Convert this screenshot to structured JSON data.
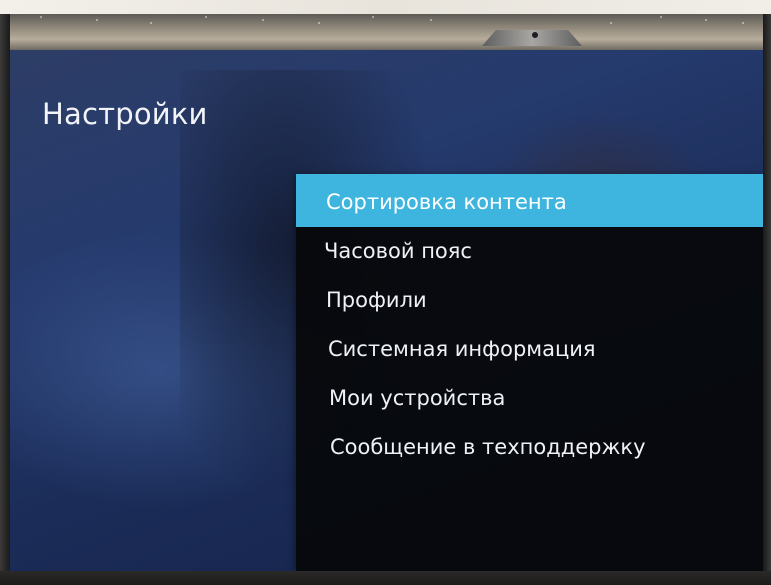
{
  "screen": {
    "title": "Настройки"
  },
  "menu": {
    "items": [
      {
        "label": "Сортировка контента",
        "selected": true
      },
      {
        "label": "Часовой пояс",
        "selected": false
      },
      {
        "label": "Профили",
        "selected": false
      },
      {
        "label": "Системная информация",
        "selected": false
      },
      {
        "label": "Мои устройства",
        "selected": false
      },
      {
        "label": "Сообщение в техподдержку",
        "selected": false
      }
    ]
  },
  "colors": {
    "screen_background": "#253a6d",
    "menu_background": "#06070a",
    "selection_highlight": "#3eb5df",
    "text": "#eef1f6"
  }
}
